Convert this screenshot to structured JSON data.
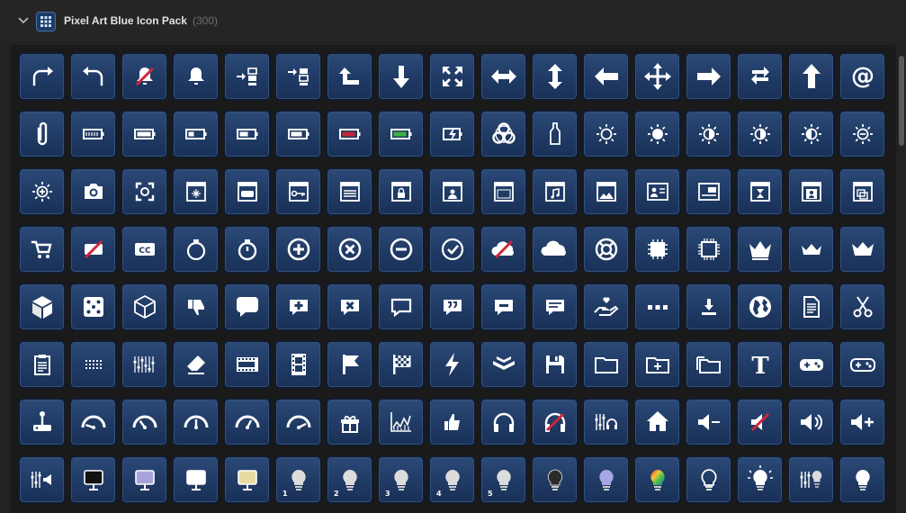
{
  "pack": {
    "title": "Pixel Art Blue Icon Pack",
    "count": "(300)"
  },
  "colors": {
    "tile": "#1f3a64",
    "tile_border": "#101b2c",
    "background": "#222222"
  },
  "icons": [
    "redo-arrow-icon",
    "undo-arrow-icon",
    "bell-off-icon",
    "bell-icon",
    "align-right-icon",
    "align-left-icon",
    "arrow-up-left-icon",
    "arrow-down-icon",
    "expand-icon",
    "arrows-horizontal-icon",
    "arrows-vertical-icon",
    "arrow-left-icon",
    "move-icon",
    "arrow-right-icon",
    "swap-arrows-icon",
    "arrow-up-icon",
    "at-sign-icon",
    "paperclip-icon",
    "battery-empty-icon",
    "battery-full-icon",
    "battery-low-icon",
    "battery-half-icon",
    "battery-high-icon",
    "battery-critical-icon",
    "battery-charged-icon",
    "battery-charging-icon",
    "biohazard-icon",
    "bottle-icon",
    "sun-outline-icon",
    "sun-filled-icon",
    "sun-icon",
    "brightness-half-icon",
    "brightness-quarter-icon",
    "brightness-minus-icon",
    "brightness-plus-icon",
    "camera-icon",
    "camera-focus-icon",
    "card-sparkle-icon",
    "card-gamepad-icon",
    "card-key-icon",
    "card-list-icon",
    "card-lock-icon",
    "card-person-icon",
    "card-blank-icon",
    "card-music-icon",
    "card-image-icon",
    "card-contact-icon",
    "card-id-icon",
    "card-hourglass-icon",
    "card-user-icon",
    "card-copy-icon",
    "shopping-cart-icon",
    "no-video-icon",
    "closed-caption-icon",
    "stopwatch-outline-icon",
    "stopwatch-icon",
    "plus-circle-icon",
    "x-circle-icon",
    "minus-circle-icon",
    "check-circle-icon",
    "cloud-off-icon",
    "cloud-icon",
    "lifebuoy-icon",
    "chip-icon",
    "chip-outline-icon",
    "crown-icon",
    "crown-small-icon",
    "crown-base-icon",
    "cube-icon",
    "dice-icon",
    "cube-outline-icon",
    "thumbs-down-icon",
    "speech-bubble-icon",
    "speech-add-icon",
    "speech-delete-icon",
    "speech-outline-icon",
    "speech-quote-icon",
    "speech-minus-icon",
    "speech-text-icon",
    "hand-heart-icon",
    "ellipsis-icon",
    "download-icon",
    "globe-icon",
    "document-icon",
    "scissors-icon",
    "clipboard-icon",
    "dotted-grid-icon",
    "equalizer-icon",
    "eraser-icon",
    "film-strip-icon",
    "film-reel-icon",
    "flag-icon",
    "checkered-flag-icon",
    "lightning-icon",
    "wide-arrows-icon",
    "floppy-disk-icon",
    "folder-icon",
    "folder-add-icon",
    "folders-icon",
    "text-icon",
    "gamepad-icon",
    "gamepad-outline-icon",
    "joystick-icon",
    "gauge-low-icon",
    "gauge-quarter-icon",
    "gauge-half-icon",
    "gauge-mid-icon",
    "gauge-high-icon",
    "gift-icon",
    "chart-icon",
    "thumbs-up-icon",
    "headphones-icon",
    "headphones-off-icon",
    "mixer-headphones-icon",
    "home-icon",
    "volume-down-icon",
    "volume-mute-icon",
    "volume-up-icon",
    "volume-plus-icon",
    "mixer-speaker-icon",
    "lamp-dark-icon",
    "lamp-purple-icon",
    "lamp-white-icon",
    "lamp-yellow-icon",
    "bulb-1-icon",
    "bulb-2-icon",
    "bulb-3-icon",
    "bulb-4-icon",
    "bulb-5-icon",
    "bulb-dark-icon",
    "bulb-purple-icon",
    "bulb-rainbow-icon",
    "bulb-outline-icon",
    "bulb-glow-icon",
    "mixer-bulb-icon",
    "bulb-white-icon"
  ],
  "bulb_numbers": {
    "bulb-1-icon": "1",
    "bulb-2-icon": "2",
    "bulb-3-icon": "3",
    "bulb-4-icon": "4",
    "bulb-5-icon": "5"
  }
}
